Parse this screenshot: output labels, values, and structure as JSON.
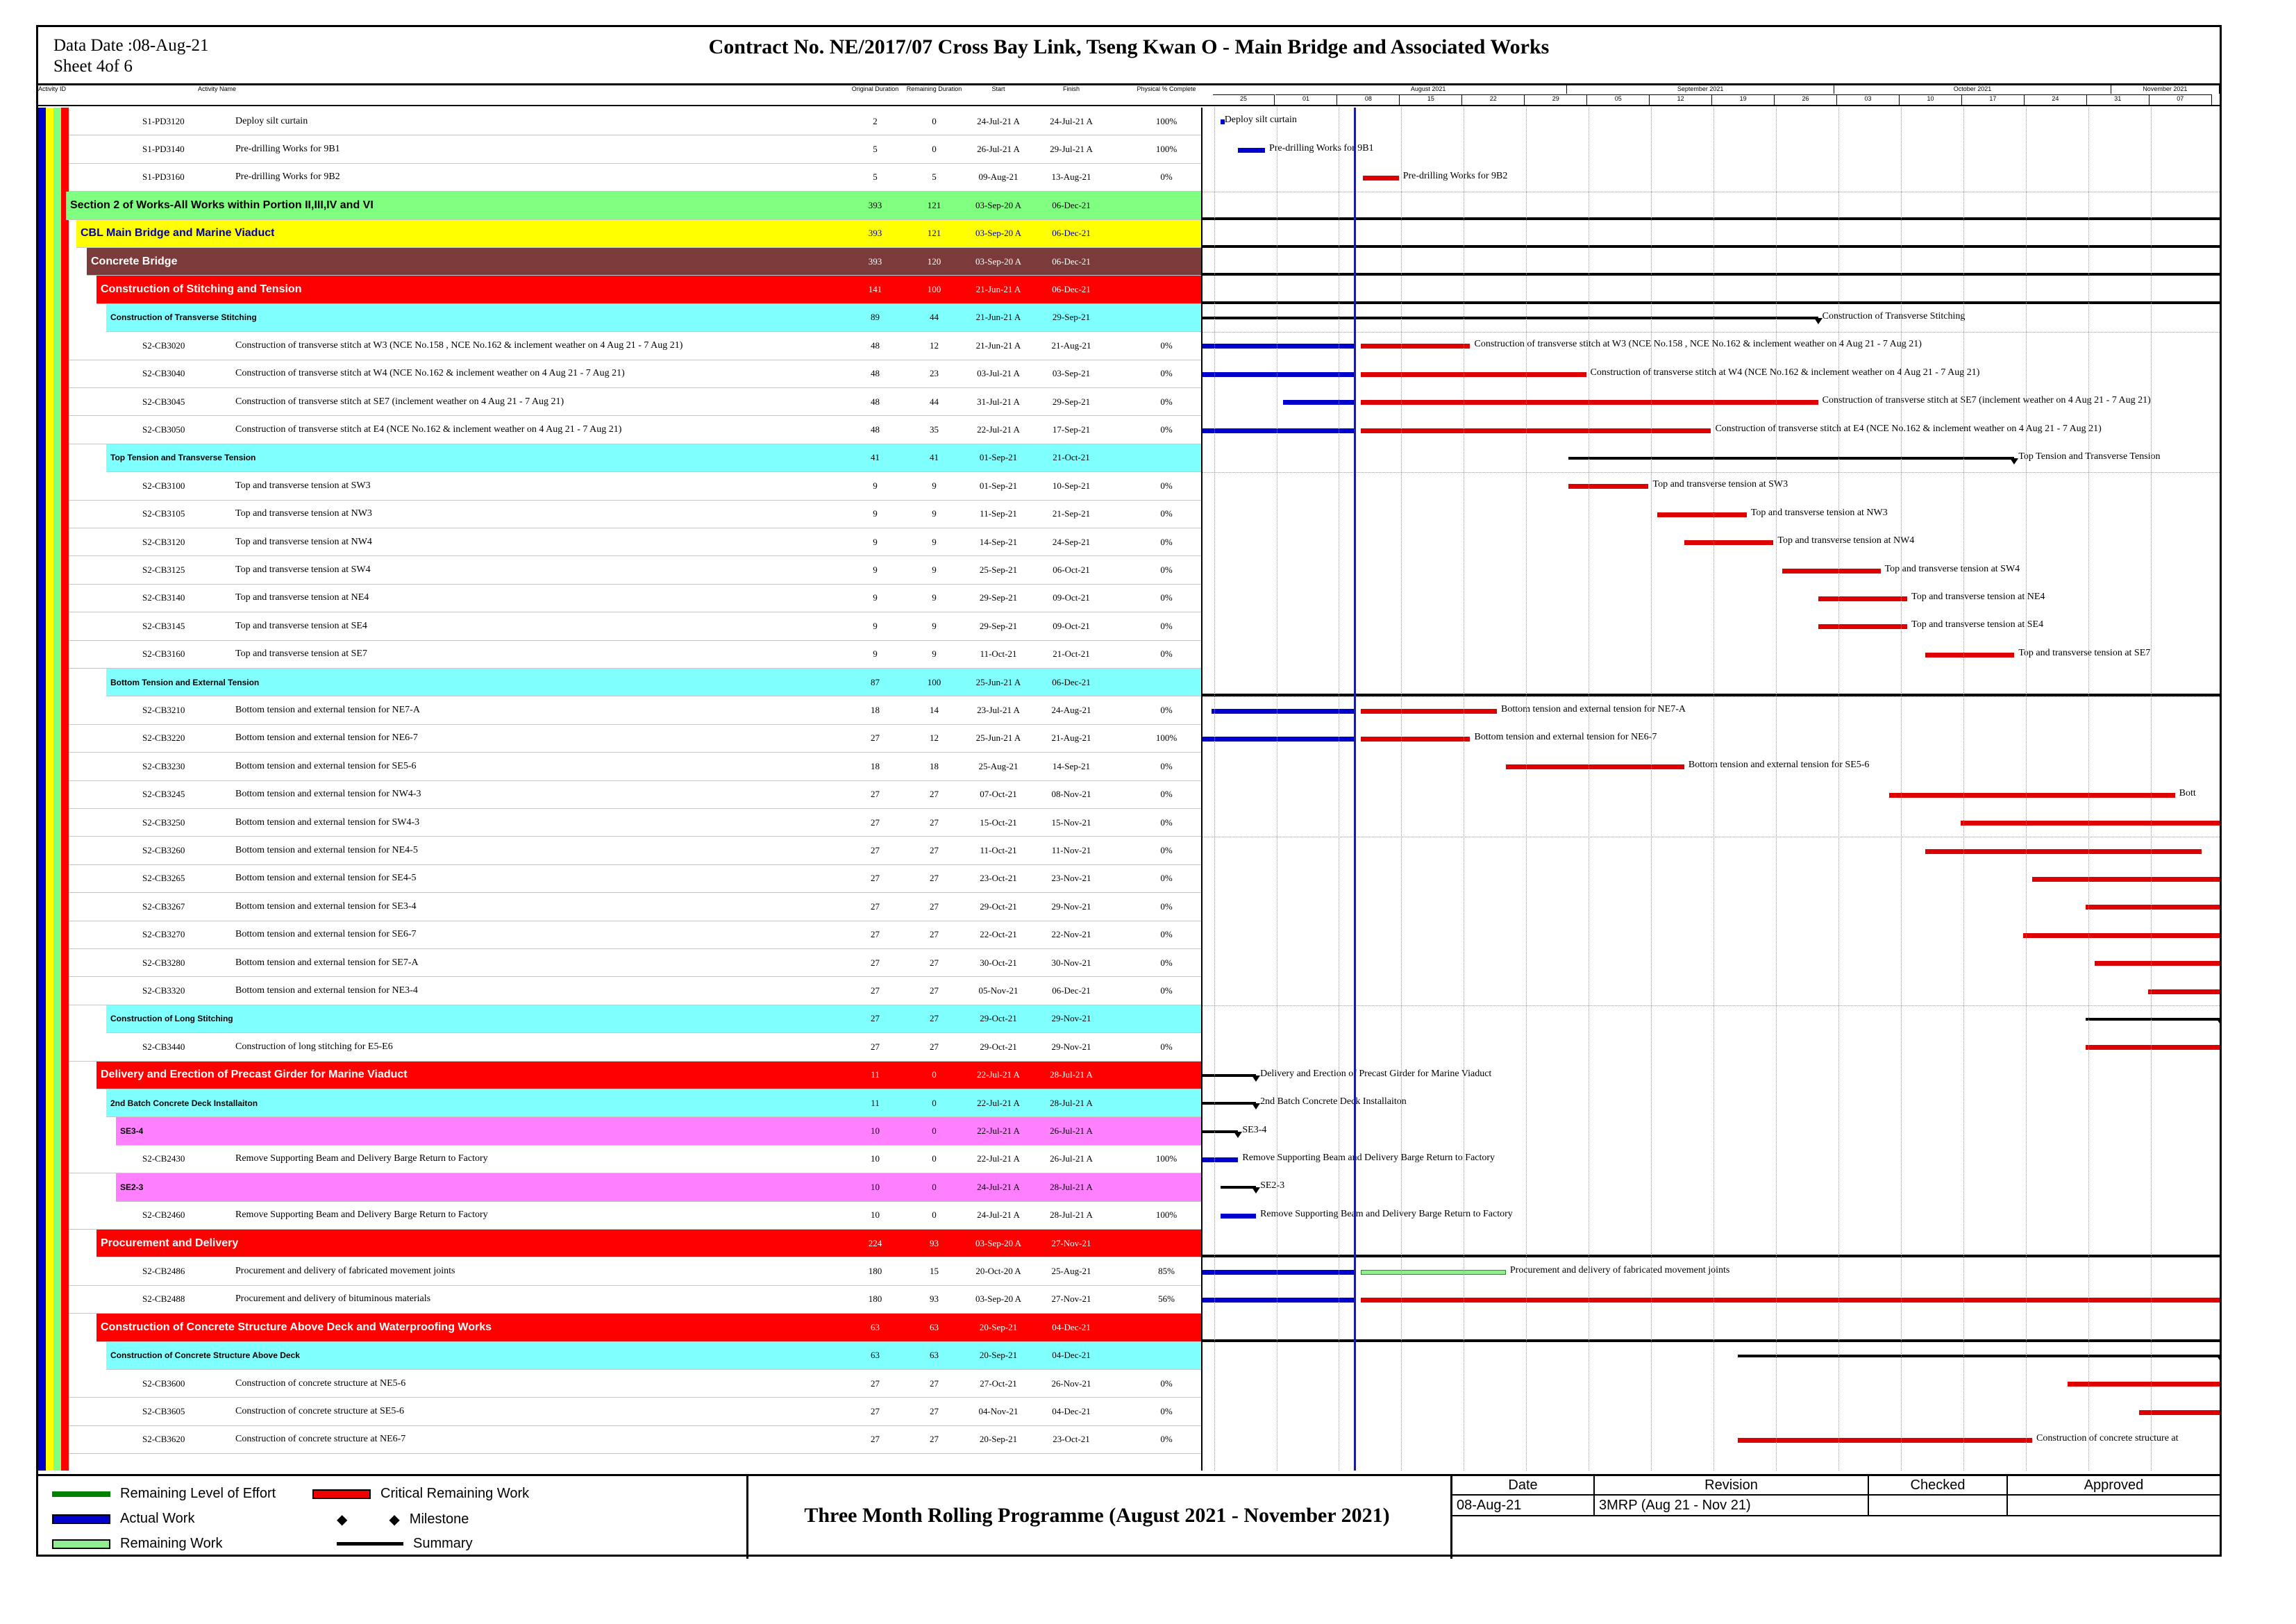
{
  "header": {
    "data_date": "Data Date :08-Aug-21",
    "sheet": "Sheet 4of 6",
    "title": "Contract  No. NE/2017/07  Cross Bay Link, Tseng Kwan O - Main Bridge and Associated Works"
  },
  "columns": {
    "activity_id": "Activity ID",
    "activity_name": "Activity Name",
    "orig_dur": "Original Duration",
    "rem_dur": "Remaining Duration",
    "start": "Start",
    "finish": "Finish",
    "pct": "Physical % Complete"
  },
  "timescale": {
    "months": [
      "August 2021",
      "September 2021",
      "October 2021",
      "November 2021"
    ],
    "weeks": [
      "25",
      "01",
      "08",
      "15",
      "22",
      "29",
      "05",
      "12",
      "19",
      "26",
      "03",
      "10",
      "17",
      "24",
      "31",
      "07"
    ]
  },
  "colors": {
    "actual": "#0000cc",
    "critical": "#dd0000",
    "remaining": "#90ee90",
    "level_of_effort": "#008000",
    "band_section": "#80ff80",
    "band_bridge": "#ffff00",
    "band_concrete": "#7b3b3b",
    "band_red": "#ff0000",
    "band_cyan": "#80ffff",
    "band_magenta": "#ff80ff",
    "dataline": "#1a1a9c"
  },
  "rows": [
    {
      "id": "S1-PD3120",
      "name": "Deploy silt curtain",
      "od": "2",
      "rd": "0",
      "start": "24-Jul-21 A",
      "finish": "24-Jul-21 A",
      "pct": "100%",
      "bar_label": "Deploy silt curtain"
    },
    {
      "id": "S1-PD3140",
      "name": "Pre-drilling Works for 9B1",
      "od": "5",
      "rd": "0",
      "start": "26-Jul-21 A",
      "finish": "29-Jul-21 A",
      "pct": "100%",
      "bar_label": "Pre-drilling Works for 9B1"
    },
    {
      "id": "S1-PD3160",
      "name": "Pre-drilling Works for 9B2",
      "od": "5",
      "rd": "5",
      "start": "09-Aug-21",
      "finish": "13-Aug-21",
      "pct": "0%",
      "bar_label": "Pre-drilling Works for 9B2"
    },
    {
      "band": "Section 2 of Works-All Works within Portion II,III,IV and VI",
      "od": "393",
      "rd": "121",
      "start": "03-Sep-20 A",
      "finish": "06-Dec-21"
    },
    {
      "band": "CBL Main Bridge and Marine Viaduct",
      "od": "393",
      "rd": "121",
      "start": "03-Sep-20 A",
      "finish": "06-Dec-21"
    },
    {
      "band": "Concrete Bridge",
      "od": "393",
      "rd": "120",
      "start": "03-Sep-20 A",
      "finish": "06-Dec-21"
    },
    {
      "band": "Construction of Stitching and Tension",
      "od": "141",
      "rd": "100",
      "start": "21-Jun-21 A",
      "finish": "06-Dec-21"
    },
    {
      "band": "Construction of Transverse Stitching",
      "od": "89",
      "rd": "44",
      "start": "21-Jun-21 A",
      "finish": "29-Sep-21",
      "bar_label": "Construction of Transverse Stitching"
    },
    {
      "id": "S2-CB3020",
      "name": "Construction of transverse stitch at W3 (NCE No.158 , NCE No.162 & inclement weather on 4 Aug 21 - 7 Aug 21)",
      "od": "48",
      "rd": "12",
      "start": "21-Jun-21 A",
      "finish": "21-Aug-21",
      "pct": "0%",
      "bar_label": "Construction of transverse stitch at W3 (NCE No.158 , NCE No.162 & inclement weather on 4 Aug 21 - 7 Aug 21)"
    },
    {
      "id": "S2-CB3040",
      "name": "Construction of transverse stitch at W4 (NCE No.162 & inclement weather on 4 Aug 21 - 7 Aug 21)",
      "od": "48",
      "rd": "23",
      "start": "03-Jul-21 A",
      "finish": "03-Sep-21",
      "pct": "0%",
      "bar_label": "Construction of transverse stitch at W4 (NCE No.162 & inclement weather on 4 Aug 21 - 7 Aug 21)"
    },
    {
      "id": "S2-CB3045",
      "name": "Construction of transverse stitch at SE7 (inclement weather on 4 Aug 21 - 7 Aug 21)",
      "od": "48",
      "rd": "44",
      "start": "31-Jul-21 A",
      "finish": "29-Sep-21",
      "pct": "0%",
      "bar_label": "Construction of transverse stitch at SE7 (inclement weather on 4 Aug 21 - 7 Aug 21)"
    },
    {
      "id": "S2-CB3050",
      "name": "Construction of transverse stitch at E4 (NCE No.162 & inclement weather on 4 Aug 21 - 7 Aug 21)",
      "od": "48",
      "rd": "35",
      "start": "22-Jul-21 A",
      "finish": "17-Sep-21",
      "pct": "0%",
      "bar_label": "Construction of transverse stitch at E4 (NCE No.162 & inclement weather on 4 Aug 21 - 7 Aug 21)"
    },
    {
      "band": "Top Tension and Transverse Tension",
      "od": "41",
      "rd": "41",
      "start": "01-Sep-21",
      "finish": "21-Oct-21",
      "bar_label": "Top Tension and Transverse Tension"
    },
    {
      "id": "S2-CB3100",
      "name": "Top and transverse tension at SW3",
      "od": "9",
      "rd": "9",
      "start": "01-Sep-21",
      "finish": "10-Sep-21",
      "pct": "0%",
      "bar_label": "Top and transverse tension at SW3"
    },
    {
      "id": "S2-CB3105",
      "name": "Top and transverse tension at NW3",
      "od": "9",
      "rd": "9",
      "start": "11-Sep-21",
      "finish": "21-Sep-21",
      "pct": "0%",
      "bar_label": "Top and transverse tension at NW3"
    },
    {
      "id": "S2-CB3120",
      "name": "Top and transverse tension at NW4",
      "od": "9",
      "rd": "9",
      "start": "14-Sep-21",
      "finish": "24-Sep-21",
      "pct": "0%",
      "bar_label": "Top and transverse tension at NW4"
    },
    {
      "id": "S2-CB3125",
      "name": "Top and transverse tension at SW4",
      "od": "9",
      "rd": "9",
      "start": "25-Sep-21",
      "finish": "06-Oct-21",
      "pct": "0%",
      "bar_label": "Top and transverse tension at SW4"
    },
    {
      "id": "S2-CB3140",
      "name": "Top and transverse tension at NE4",
      "od": "9",
      "rd": "9",
      "start": "29-Sep-21",
      "finish": "09-Oct-21",
      "pct": "0%",
      "bar_label": "Top and transverse tension at NE4"
    },
    {
      "id": "S2-CB3145",
      "name": "Top and transverse tension at SE4",
      "od": "9",
      "rd": "9",
      "start": "29-Sep-21",
      "finish": "09-Oct-21",
      "pct": "0%",
      "bar_label": "Top and transverse tension at SE4"
    },
    {
      "id": "S2-CB3160",
      "name": "Top and transverse tension at SE7",
      "od": "9",
      "rd": "9",
      "start": "11-Oct-21",
      "finish": "21-Oct-21",
      "pct": "0%",
      "bar_label": "Top and transverse tension at SE7"
    },
    {
      "band": "Bottom Tension and External Tension",
      "od": "87",
      "rd": "100",
      "start": "25-Jun-21 A",
      "finish": "06-Dec-21"
    },
    {
      "id": "S2-CB3210",
      "name": "Bottom tension and external tension for NE7-A",
      "od": "18",
      "rd": "14",
      "start": "23-Jul-21 A",
      "finish": "24-Aug-21",
      "pct": "0%",
      "bar_label": "Bottom tension and external tension for NE7-A"
    },
    {
      "id": "S2-CB3220",
      "name": "Bottom tension and external tension for NE6-7",
      "od": "27",
      "rd": "12",
      "start": "25-Jun-21 A",
      "finish": "21-Aug-21",
      "pct": "100%",
      "bar_label": "Bottom tension and external tension for NE6-7"
    },
    {
      "id": "S2-CB3230",
      "name": "Bottom tension and external tension for SE5-6",
      "od": "18",
      "rd": "18",
      "start": "25-Aug-21",
      "finish": "14-Sep-21",
      "pct": "0%",
      "bar_label": "Bottom tension and external tension for SE5-6"
    },
    {
      "id": "S2-CB3245",
      "name": "Bottom tension and external tension for NW4-3",
      "od": "27",
      "rd": "27",
      "start": "07-Oct-21",
      "finish": "08-Nov-21",
      "pct": "0%",
      "bar_label": "Bott"
    },
    {
      "id": "S2-CB3250",
      "name": "Bottom tension and external tension for SW4-3",
      "od": "27",
      "rd": "27",
      "start": "15-Oct-21",
      "finish": "15-Nov-21",
      "pct": "0%"
    },
    {
      "id": "S2-CB3260",
      "name": "Bottom tension and external tension for NE4-5",
      "od": "27",
      "rd": "27",
      "start": "11-Oct-21",
      "finish": "11-Nov-21",
      "pct": "0%"
    },
    {
      "id": "S2-CB3265",
      "name": "Bottom tension and external tension for SE4-5",
      "od": "27",
      "rd": "27",
      "start": "23-Oct-21",
      "finish": "23-Nov-21",
      "pct": "0%"
    },
    {
      "id": "S2-CB3267",
      "name": "Bottom tension and external tension for SE3-4",
      "od": "27",
      "rd": "27",
      "start": "29-Oct-21",
      "finish": "29-Nov-21",
      "pct": "0%"
    },
    {
      "id": "S2-CB3270",
      "name": "Bottom tension and external tension for SE6-7",
      "od": "27",
      "rd": "27",
      "start": "22-Oct-21",
      "finish": "22-Nov-21",
      "pct": "0%"
    },
    {
      "id": "S2-CB3280",
      "name": "Bottom tension and external tension for SE7-A",
      "od": "27",
      "rd": "27",
      "start": "30-Oct-21",
      "finish": "30-Nov-21",
      "pct": "0%"
    },
    {
      "id": "S2-CB3320",
      "name": "Bottom tension and external tension for NE3-4",
      "od": "27",
      "rd": "27",
      "start": "05-Nov-21",
      "finish": "06-Dec-21",
      "pct": "0%"
    },
    {
      "band": "Construction of Long Stitching",
      "od": "27",
      "rd": "27",
      "start": "29-Oct-21",
      "finish": "29-Nov-21"
    },
    {
      "id": "S2-CB3440",
      "name": "Construction of long stitching for E5-E6",
      "od": "27",
      "rd": "27",
      "start": "29-Oct-21",
      "finish": "29-Nov-21",
      "pct": "0%"
    },
    {
      "band": "Delivery and Erection of Precast Girder for Marine Viaduct",
      "od": "11",
      "rd": "0",
      "start": "22-Jul-21 A",
      "finish": "28-Jul-21 A",
      "bar_label": "Delivery and Erection of Precast Girder for Marine Viaduct"
    },
    {
      "band": "2nd Batch Concrete Deck Installaiton",
      "od": "11",
      "rd": "0",
      "start": "22-Jul-21 A",
      "finish": "28-Jul-21 A",
      "bar_label": "2nd Batch Concrete Deck Installaiton"
    },
    {
      "band": "SE3-4",
      "od": "10",
      "rd": "0",
      "start": "22-Jul-21 A",
      "finish": "26-Jul-21 A",
      "bar_label": "SE3-4"
    },
    {
      "id": "S2-CB2430",
      "name": "Remove Supporting Beam and Delivery Barge Return to Factory",
      "od": "10",
      "rd": "0",
      "start": "22-Jul-21 A",
      "finish": "26-Jul-21 A",
      "pct": "100%",
      "bar_label": "Remove Supporting Beam and Delivery Barge Return to Factory"
    },
    {
      "band": "SE2-3",
      "od": "10",
      "rd": "0",
      "start": "24-Jul-21 A",
      "finish": "28-Jul-21 A",
      "bar_label": "SE2-3"
    },
    {
      "id": "S2-CB2460",
      "name": "Remove Supporting Beam and Delivery Barge Return to Factory",
      "od": "10",
      "rd": "0",
      "start": "24-Jul-21 A",
      "finish": "28-Jul-21 A",
      "pct": "100%",
      "bar_label": "Remove Supporting Beam and Delivery Barge Return to Factory"
    },
    {
      "band": "Procurement and Delivery",
      "od": "224",
      "rd": "93",
      "start": "03-Sep-20 A",
      "finish": "27-Nov-21"
    },
    {
      "id": "S2-CB2486",
      "name": "Procurement and delivery of fabricated movement joints",
      "od": "180",
      "rd": "15",
      "start": "20-Oct-20 A",
      "finish": "25-Aug-21",
      "pct": "85%",
      "bar_label": "Procurement and delivery of fabricated movement joints"
    },
    {
      "id": "S2-CB2488",
      "name": "Procurement and delivery of bituminous materials",
      "od": "180",
      "rd": "93",
      "start": "03-Sep-20 A",
      "finish": "27-Nov-21",
      "pct": "56%"
    },
    {
      "band": "Construction of Concrete Structure Above Deck and Waterproofing Works",
      "od": "63",
      "rd": "63",
      "start": "20-Sep-21",
      "finish": "04-Dec-21"
    },
    {
      "band": "Construction of Concrete Structure Above Deck",
      "od": "63",
      "rd": "63",
      "start": "20-Sep-21",
      "finish": "04-Dec-21"
    },
    {
      "id": "S2-CB3600",
      "name": "Construction of concrete structure at NE5-6",
      "od": "27",
      "rd": "27",
      "start": "27-Oct-21",
      "finish": "26-Nov-21",
      "pct": "0%"
    },
    {
      "id": "S2-CB3605",
      "name": "Construction of concrete structure at SE5-6",
      "od": "27",
      "rd": "27",
      "start": "04-Nov-21",
      "finish": "04-Dec-21",
      "pct": "0%"
    },
    {
      "id": "S2-CB3620",
      "name": "Construction of concrete structure at NE6-7",
      "od": "27",
      "rd": "27",
      "start": "20-Sep-21",
      "finish": "23-Oct-21",
      "pct": "0%",
      "bar_label": "Construction of concrete structure at"
    }
  ],
  "legend": {
    "level_of_effort": "Remaining Level of Effort",
    "actual": "Actual Work",
    "remaining": "Remaining Work",
    "critical": "Critical Remaining Work",
    "milestone": "Milestone",
    "summary": "Summary"
  },
  "footer": {
    "title": "Three Month Rolling Programme (August 2021 - November 2021)",
    "date_h": "Date",
    "revision_h": "Revision",
    "checked_h": "Checked",
    "approved_h": "Approved",
    "date": "08-Aug-21",
    "revision": "3MRP (Aug 21 - Nov 21)"
  }
}
